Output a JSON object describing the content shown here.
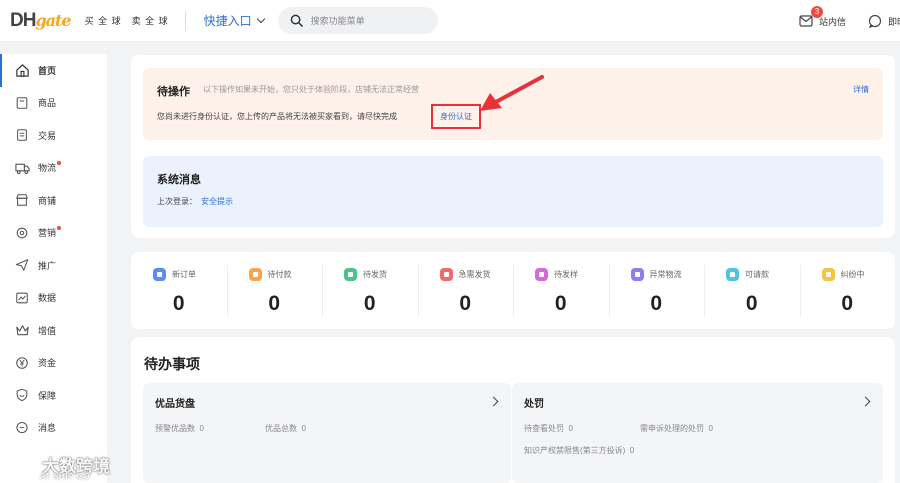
{
  "topbar": {
    "logo_dh": "DH",
    "logo_gate": "gate",
    "link_buy": "买 全 球",
    "link_sell": "卖 全 球",
    "quick_entry": "快捷入口",
    "search_placeholder": "搜索功能菜单",
    "messages_label": "站内信",
    "messages_count": "3",
    "im_label": "即时"
  },
  "sidebar": {
    "items": [
      {
        "label": "首页",
        "icon": "home-icon",
        "active": true,
        "dot": false
      },
      {
        "label": "商品",
        "icon": "product-icon",
        "active": false,
        "dot": false
      },
      {
        "label": "交易",
        "icon": "order-icon",
        "active": false,
        "dot": false
      },
      {
        "label": "物流",
        "icon": "truck-icon",
        "active": false,
        "dot": true
      },
      {
        "label": "商铺",
        "icon": "store-icon",
        "active": false,
        "dot": false
      },
      {
        "label": "营销",
        "icon": "marketing-icon",
        "active": false,
        "dot": true
      },
      {
        "label": "推广",
        "icon": "paper-plane-icon",
        "active": false,
        "dot": false
      },
      {
        "label": "数据",
        "icon": "chart-icon",
        "active": false,
        "dot": false
      },
      {
        "label": "增值",
        "icon": "crown-icon",
        "active": false,
        "dot": false
      },
      {
        "label": "资金",
        "icon": "yen-icon",
        "active": false,
        "dot": false
      },
      {
        "label": "保障",
        "icon": "shield-icon",
        "active": false,
        "dot": false
      },
      {
        "label": "消息",
        "icon": "chat-icon",
        "active": false,
        "dot": false
      }
    ]
  },
  "pending": {
    "title": "待操作",
    "hint": "以下操作如果未开始，您只处于体验阶段，店铺无法正常经营",
    "detail": "详情",
    "notice": "您尚未进行身份认证，您上传的产品将无法被买家看到，请尽快完成",
    "verify_link": "身份认证"
  },
  "system": {
    "title": "系统消息",
    "last_login_label": "上次登录：",
    "security_tip": "安全提示"
  },
  "stats": [
    {
      "label": "新订单",
      "value": "0",
      "color": "#5b8def"
    },
    {
      "label": "待付款",
      "value": "0",
      "color": "#f5a54a"
    },
    {
      "label": "待发货",
      "value": "0",
      "color": "#4cc38a"
    },
    {
      "label": "急需发货",
      "value": "0",
      "color": "#f06a6a"
    },
    {
      "label": "待发样",
      "value": "0",
      "color": "#d46bd8"
    },
    {
      "label": "异常物流",
      "value": "0",
      "color": "#8f7cf0"
    },
    {
      "label": "可请款",
      "value": "0",
      "color": "#4fc3e0"
    },
    {
      "label": "纠纷中",
      "value": "0",
      "color": "#f5c542"
    }
  ],
  "todo": {
    "title": "待办事项",
    "left": {
      "title": "优品货盘",
      "items": [
        {
          "label": "预警优品数",
          "value": "0"
        },
        {
          "label": "优品总数",
          "value": "0"
        }
      ]
    },
    "right": {
      "title": "处罚",
      "items": [
        {
          "label": "待查看处罚",
          "value": "0"
        },
        {
          "label": "需申诉处理的处罚",
          "value": "0"
        },
        {
          "label": "知识产权禁限售(第三方投诉)",
          "value": "0"
        }
      ]
    }
  },
  "watermark": {
    "text": "大数跨境",
    "sub": "AT SHIP GO"
  },
  "colors": {
    "accent": "#2b6fd4",
    "alert_red": "#e8323a",
    "pending_bg": "#fdf1ea",
    "system_bg": "#ecf2fd"
  }
}
